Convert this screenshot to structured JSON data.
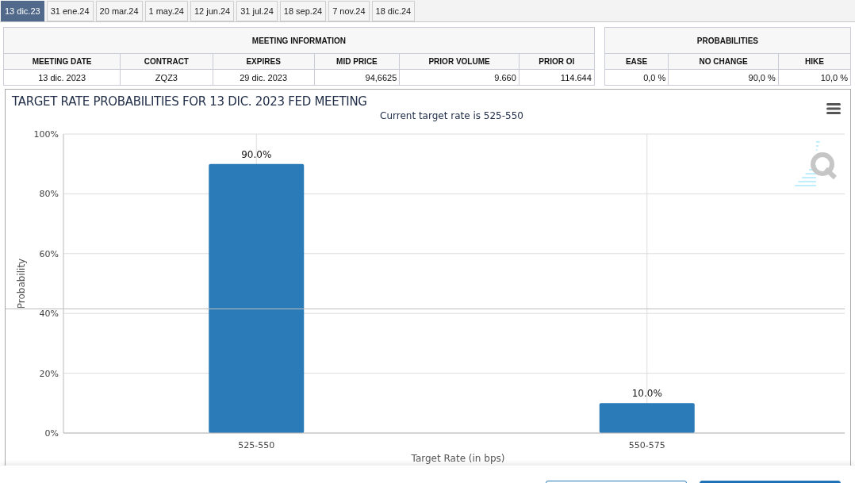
{
  "tabs": [
    {
      "label": "13 dic.23",
      "selected": true
    },
    {
      "label": "31 ene.24",
      "selected": false
    },
    {
      "label": "20 mar.24",
      "selected": false
    },
    {
      "label": "1 may.24",
      "selected": false
    },
    {
      "label": "12 jun.24",
      "selected": false
    },
    {
      "label": "31 jul.24",
      "selected": false
    },
    {
      "label": "18 sep.24",
      "selected": false
    },
    {
      "label": "7 nov.24",
      "selected": false
    },
    {
      "label": "18 dic.24",
      "selected": false
    }
  ],
  "meeting_information": {
    "title": "MEETING INFORMATION",
    "columns": [
      "MEETING DATE",
      "CONTRACT",
      "EXPIRES",
      "MID PRICE",
      "PRIOR VOLUME",
      "PRIOR OI"
    ],
    "row": [
      "13 dic. 2023",
      "ZQZ3",
      "29 dic. 2023",
      "94,6625",
      "9.660",
      "114.644"
    ]
  },
  "probabilities": {
    "title": "PROBABILITIES",
    "columns": [
      "EASE",
      "NO CHANGE",
      "HIKE"
    ],
    "row": [
      "0,0 %",
      "90,0 %",
      "10,0 %"
    ]
  },
  "chart": {
    "title": "TARGET RATE PROBABILITIES FOR 13 DIC. 2023 FED MEETING",
    "subtitle": "Current target rate is 525-550",
    "chart_data": {
      "type": "bar",
      "xlabel": "Target Rate (in bps)",
      "ylabel": "Probability",
      "categories": [
        "525-550",
        "550-575"
      ],
      "series": [
        {
          "color": "#2b7bb9",
          "values": [
            90.0,
            10.0
          ]
        }
      ],
      "grid": true,
      "ylim": [
        0,
        100
      ],
      "yticks": [
        {
          "value": 0,
          "label": "0%"
        },
        {
          "value": 20,
          "label": "20%"
        },
        {
          "value": 40,
          "label": "40%"
        },
        {
          "value": 60,
          "label": "60%"
        },
        {
          "value": 80,
          "label": "80%"
        },
        {
          "value": 100,
          "label": "100%"
        }
      ],
      "value_labels": [
        "90.0%",
        "10.0%"
      ]
    }
  }
}
